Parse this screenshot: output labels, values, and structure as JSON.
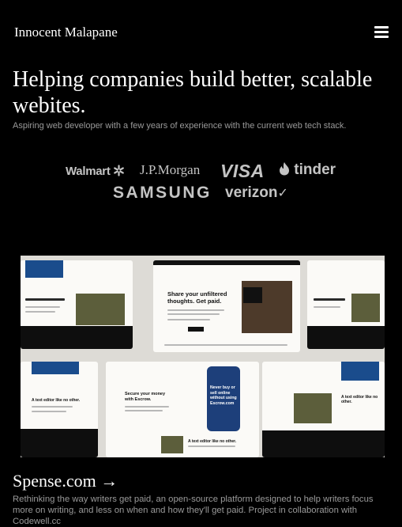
{
  "header": {
    "brand": "Innocent Malapane",
    "menu_icon": "hamburger-menu-icon"
  },
  "hero": {
    "title": "Helping companies build better, scalable webites.",
    "subtitle": "Aspiring web developer with a few years of experience with the current web tech stack."
  },
  "clients": {
    "walmart": "Walmart",
    "jpmorgan": "J.P.Morgan",
    "visa": "VISA",
    "tinder": "tinder",
    "samsung": "SAMSUNG",
    "verizon": "verizon"
  },
  "project": {
    "title": "Spense.com →",
    "description": "Rethinking the way writers get paid, an open-source platform designed to help writers focus more on writing, and less on when and how they'll get paid. Project in collaboration with Codewell.cc",
    "screenshot_texts": {
      "hero_card": "Share your unfiltered thoughts. Get paid.",
      "money_card": "Secure your money with Escrow.",
      "phone_card": "Never buy or sell online without using Escrow.com",
      "editor_card": "A text editor like no other."
    }
  }
}
